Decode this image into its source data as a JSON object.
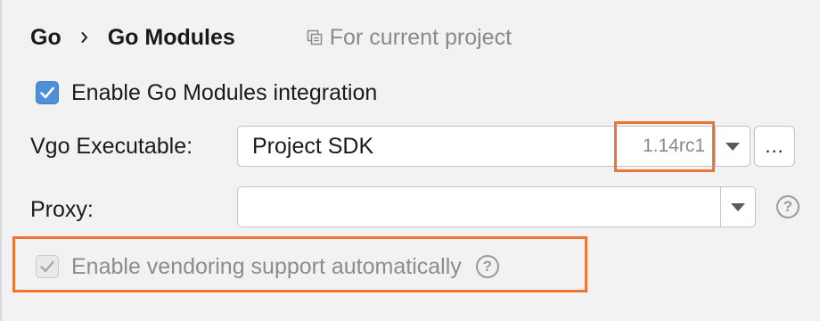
{
  "breadcrumb": {
    "parent": "Go",
    "current": "Go Modules",
    "scope_label": "For current project"
  },
  "enable_modules": {
    "label": "Enable Go Modules integration",
    "checked": true
  },
  "vgo_executable": {
    "label": "Vgo Executable:",
    "value": "Project SDK",
    "version": "1.14rc1",
    "browse_label": "..."
  },
  "proxy": {
    "label": "Proxy:",
    "value": "",
    "help": "?"
  },
  "vendoring": {
    "label": "Enable vendoring support automatically",
    "checked": true,
    "enabled": false,
    "help": "?"
  },
  "colors": {
    "highlight": "#ec7535",
    "checkbox_accent": "#4d8fd8",
    "background": "#f2f2f2"
  }
}
